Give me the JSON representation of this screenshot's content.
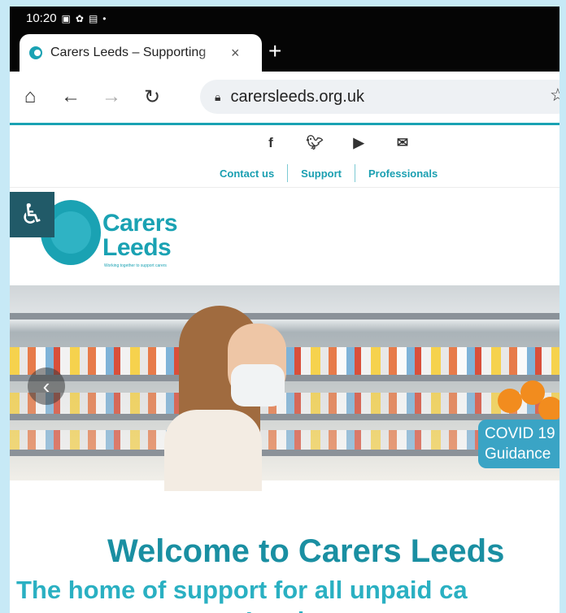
{
  "status_bar": {
    "time": "10:20"
  },
  "tab": {
    "title": "Carers Leeds – Supporting",
    "close": "×"
  },
  "new_tab": "+",
  "toolbar": {
    "url": "carersleeds.org.uk"
  },
  "socials": [
    "f",
    "t",
    "youtube",
    "mail"
  ],
  "nav": {
    "contact": "Contact us",
    "support": "Support",
    "professionals": "Professionals"
  },
  "logo": {
    "line1": "Carers",
    "line2": "Leeds",
    "tagline": "Working together to support carers"
  },
  "hero": {
    "badge_line1": "COVID 19",
    "badge_line2": "Guidance"
  },
  "headline": "Welcome to Carers Leeds",
  "subheadline": "The home of support for all unpaid ca",
  "subheadline_2": "Leeds",
  "colors": {
    "brand_teal": "#1aa2b3",
    "accessibility_bg": "#215a68",
    "frame": "#c7e9f6"
  }
}
